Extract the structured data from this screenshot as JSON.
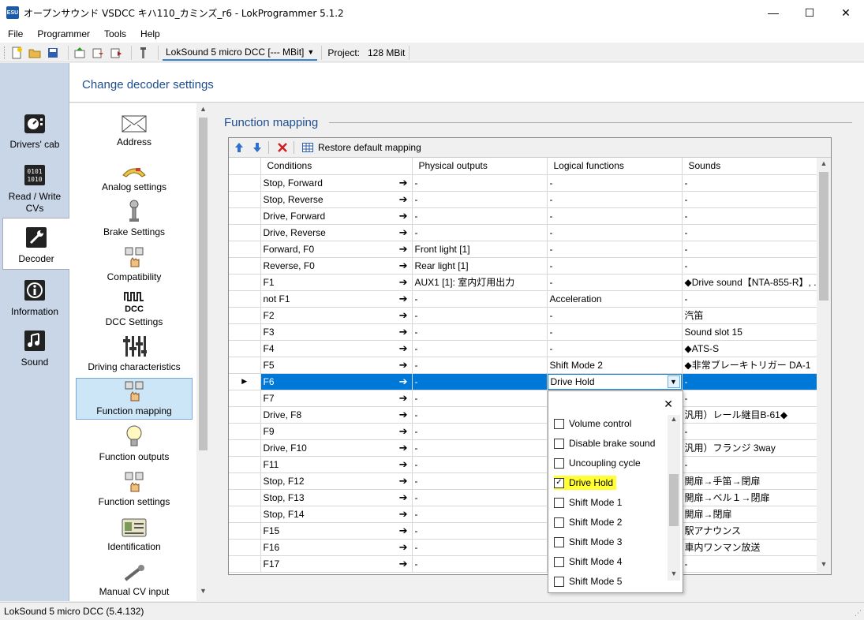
{
  "window": {
    "title": "オープンサウンド VSDCC キハ110_カミンズ_r6 - LokProgrammer 5.1.2",
    "app_icon_text": "ESU",
    "minimize": "—",
    "maximize": "☐",
    "close": "✕"
  },
  "menu": [
    "File",
    "Programmer",
    "Tools",
    "Help"
  ],
  "toolbar": {
    "decoder": "LokSound 5 micro DCC [--- MBit]",
    "project_label": "Project:",
    "project_value": "128 MBit"
  },
  "leftnav": [
    {
      "label": "Drivers' cab",
      "icon": "drivers-cab-icon"
    },
    {
      "label": "Read / Write CVs",
      "icon": "read-write-cvs-icon"
    },
    {
      "label": "Decoder",
      "icon": "wrench-icon",
      "active": true
    },
    {
      "label": "Information",
      "icon": "info-icon"
    },
    {
      "label": "Sound",
      "icon": "music-note-icon"
    }
  ],
  "header": {
    "title": "Change decoder settings"
  },
  "settings": [
    {
      "label": "Address",
      "icon": "envelope-icon"
    },
    {
      "label": "Analog settings",
      "icon": "analog-gauge-icon"
    },
    {
      "label": "Brake Settings",
      "icon": "brake-icon"
    },
    {
      "label": "Compatibility",
      "icon": "hand-buttons-icon"
    },
    {
      "label": "DCC Settings",
      "icon": "dcc-icon"
    },
    {
      "label": "Driving characteristics",
      "icon": "sliders-icon"
    },
    {
      "label": "Function mapping",
      "icon": "hand-buttons-icon",
      "active": true
    },
    {
      "label": "Function outputs",
      "icon": "lightbulb-icon"
    },
    {
      "label": "Function settings",
      "icon": "hand-buttons-icon"
    },
    {
      "label": "Identification",
      "icon": "id-card-icon"
    },
    {
      "label": "Manual CV input",
      "icon": "wrench-input-icon"
    }
  ],
  "function_mapping": {
    "group_title": "Function mapping",
    "restore_label": "Restore default mapping",
    "columns": [
      "Conditions",
      "Physical outputs",
      "Logical functions",
      "Sounds"
    ],
    "rows": [
      {
        "cond": "Stop, Forward",
        "phys": "-",
        "logic": "-",
        "sound": "-"
      },
      {
        "cond": "Stop, Reverse",
        "phys": "-",
        "logic": "-",
        "sound": "-"
      },
      {
        "cond": "Drive, Forward",
        "phys": "-",
        "logic": "-",
        "sound": "-"
      },
      {
        "cond": "Drive, Reverse",
        "phys": "-",
        "logic": "-",
        "sound": "-"
      },
      {
        "cond": "Forward, F0",
        "phys": "Front light [1]",
        "logic": "-",
        "sound": "-"
      },
      {
        "cond": "Reverse, F0",
        "phys": "Rear light [1]",
        "logic": "-",
        "sound": "-"
      },
      {
        "cond": "F1",
        "phys": "AUX1 [1]: 室内灯用出力",
        "logic": "-",
        "sound": "◆Drive sound【NTA-855-R】, ..."
      },
      {
        "cond": "not F1",
        "phys": "-",
        "logic": "Acceleration",
        "sound": "-"
      },
      {
        "cond": "F2",
        "phys": "-",
        "logic": "-",
        "sound": "汽笛"
      },
      {
        "cond": "F3",
        "phys": "-",
        "logic": "-",
        "sound": "Sound slot 15"
      },
      {
        "cond": "F4",
        "phys": "-",
        "logic": "-",
        "sound": "◆ATS-S"
      },
      {
        "cond": "F5",
        "phys": "-",
        "logic": "Shift Mode 2",
        "sound": "◆非常ブレーキトリガー DA-1"
      },
      {
        "cond": "F6",
        "phys": "-",
        "logic": "Drive Hold",
        "sound": "-",
        "selected": true
      },
      {
        "cond": "F7",
        "phys": "-",
        "logic": "",
        "sound": "-"
      },
      {
        "cond": "Drive, F8",
        "phys": "-",
        "logic": "",
        "sound": "汎用）レール継目B-61◆"
      },
      {
        "cond": "F9",
        "phys": "-",
        "logic": "",
        "sound": "-"
      },
      {
        "cond": "Drive, F10",
        "phys": "-",
        "logic": "",
        "sound": "汎用）フランジ 3way"
      },
      {
        "cond": "F11",
        "phys": "-",
        "logic": "",
        "sound": "-"
      },
      {
        "cond": "Stop, F12",
        "phys": "-",
        "logic": "",
        "sound": "開扉→手笛→閉扉"
      },
      {
        "cond": "Stop, F13",
        "phys": "-",
        "logic": "",
        "sound": "開扉→ベル１→閉扉"
      },
      {
        "cond": "Stop, F14",
        "phys": "-",
        "logic": "",
        "sound": "開扉→閉扉"
      },
      {
        "cond": "F15",
        "phys": "-",
        "logic": "",
        "sound": "駅アナウンス"
      },
      {
        "cond": "F16",
        "phys": "-",
        "logic": "",
        "sound": "車内ワンマン放送"
      },
      {
        "cond": "F17",
        "phys": "-",
        "logic": "",
        "sound": "-"
      }
    ]
  },
  "dropdown": {
    "close": "✕",
    "items": [
      {
        "label": "Volume control",
        "checked": false
      },
      {
        "label": "Disable brake sound",
        "checked": false
      },
      {
        "label": "Uncoupling cycle",
        "checked": false
      },
      {
        "label": "Drive Hold",
        "checked": true,
        "highlighted": true
      },
      {
        "label": "Shift Mode 1",
        "checked": false
      },
      {
        "label": "Shift Mode 2",
        "checked": false
      },
      {
        "label": "Shift Mode 3",
        "checked": false
      },
      {
        "label": "Shift Mode 4",
        "checked": false
      },
      {
        "label": "Shift Mode 5",
        "checked": false
      }
    ]
  },
  "status": {
    "text": "LokSound 5 micro DCC (5.4.132)"
  }
}
